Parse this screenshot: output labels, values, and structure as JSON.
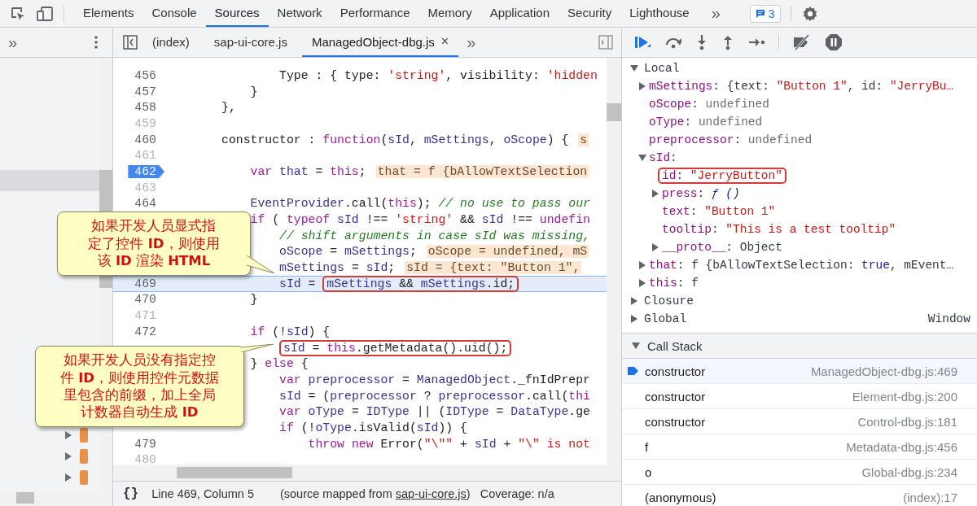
{
  "top_tabs": [
    {
      "label": "Elements",
      "selected": false
    },
    {
      "label": "Console",
      "selected": false
    },
    {
      "label": "Sources",
      "selected": true
    },
    {
      "label": "Network",
      "selected": false
    },
    {
      "label": "Performance",
      "selected": false
    },
    {
      "label": "Memory",
      "selected": false
    },
    {
      "label": "Application",
      "selected": false
    },
    {
      "label": "Security",
      "selected": false
    },
    {
      "label": "Lighthouse",
      "selected": false
    }
  ],
  "more_tabs": "»",
  "issues_count": "3",
  "navigator": {
    "more": "»"
  },
  "file_tabs": [
    {
      "label": "(index)",
      "selected": false,
      "closable": false
    },
    {
      "label": "sap-ui-core.js",
      "selected": false,
      "closable": false
    },
    {
      "label": "ManagedObject-dbg.js",
      "selected": true,
      "closable": true
    }
  ],
  "file_tabs_more": "»",
  "close_glyph": "×",
  "code": {
    "lines": [
      {
        "children": [
          {
            "children": [
              {
                "number": "456",
                "tokens": [
                  {
                    "kind": "plain",
                    "text": "Type : { type: "
                  },
                  {
                    "kind": "string",
                    "text": "'string'"
                  },
                  {
                    "kind": "plain",
                    "text": ", visibility: "
                  },
                  {
                    "kind": "string",
                    "text": "'hidden"
                  }
                ]
              }
            ]
          },
          {
            "number": "457",
            "tokens": [
              {
                "kind": "plain",
                "text": "}"
              }
            ]
          }
        ]
      },
      {
        "number": "458",
        "tokens": [
          {
            "kind": "plain",
            "text": "},"
          }
        ]
      },
      {
        "number": "459"
      },
      {
        "number": "460",
        "tokens": [
          {
            "kind": "plain",
            "text": "constructor : "
          },
          {
            "kind": "keyword",
            "text": "function"
          },
          {
            "kind": "plain",
            "text": "("
          },
          {
            "kind": "variable",
            "text": "sId"
          },
          {
            "kind": "plain",
            "text": ", "
          },
          {
            "kind": "variable",
            "text": "mSettings"
          },
          {
            "kind": "plain",
            "text": ", "
          },
          {
            "kind": "variable",
            "text": "oScope"
          },
          {
            "kind": "plain",
            "text": ") {"
          },
          {
            "kind": "inline",
            "text": "s"
          }
        ],
        "children": [
          {
            "number": "461"
          },
          {
            "number": "462",
            "breakpoint": true,
            "tokens": [
              {
                "kind": "keyword",
                "text": "var"
              },
              {
                "kind": "variable",
                "text": " that"
              },
              {
                "kind": "plain",
                "text": " = "
              },
              {
                "kind": "keyword",
                "text": "this"
              },
              {
                "kind": "plain",
                "text": ";"
              },
              {
                "kind": "inline",
                "text": "that = f {bAllowTextSelection"
              }
            ]
          },
          {
            "number": "463"
          },
          {
            "number": "464",
            "tokens": [
              {
                "kind": "variable",
                "text": "EventProvider"
              },
              {
                "kind": "plain",
                "text": ".call("
              },
              {
                "kind": "keyword",
                "text": "this"
              },
              {
                "kind": "plain",
                "text": "); "
              },
              {
                "kind": "comment",
                "text": "// no use to pass our"
              }
            ]
          },
          {
            "tokens": [
              {
                "kind": "keyword",
                "text": "if"
              },
              {
                "kind": "plain",
                "text": " ( "
              },
              {
                "kind": "keyword",
                "text": "typeof"
              },
              {
                "kind": "variable",
                "text": " sId"
              },
              {
                "kind": "plain",
                "text": " !== "
              },
              {
                "kind": "string",
                "text": "'string'"
              },
              {
                "kind": "plain",
                "text": " && "
              },
              {
                "kind": "variable",
                "text": "sId"
              },
              {
                "kind": "plain",
                "text": " !== "
              },
              {
                "kind": "keyword",
                "text": "undefin"
              }
            ],
            "children": [
              {
                "tokens": [
                  {
                    "kind": "comment",
                    "text": "// shift arguments in case sId was missing,"
                  }
                ]
              },
              {
                "tokens": [
                  {
                    "kind": "variable",
                    "text": "oScope"
                  },
                  {
                    "kind": "plain",
                    "text": " = "
                  },
                  {
                    "kind": "variable",
                    "text": "mSettings"
                  },
                  {
                    "kind": "plain",
                    "text": ";"
                  },
                  {
                    "kind": "inline",
                    "text": "oScope = undefined, mS"
                  }
                ]
              },
              {
                "tokens": [
                  {
                    "kind": "variable",
                    "text": "mSettings"
                  },
                  {
                    "kind": "plain",
                    "text": " = "
                  },
                  {
                    "kind": "variable",
                    "text": "sId"
                  },
                  {
                    "kind": "plain",
                    "text": ";"
                  },
                  {
                    "kind": "inline",
                    "text": "sId = {text: \"Button 1\","
                  }
                ]
              },
              {
                "number": "469",
                "current": true,
                "tokens": [
                  {
                    "kind": "variable",
                    "text": "sId"
                  },
                  {
                    "kind": "plain",
                    "text": " = "
                  }
                ],
                "boxed_tokens": [
                  {
                    "kind": "variable",
                    "text": "mSettings"
                  },
                  {
                    "kind": "plain",
                    "text": " && "
                  },
                  {
                    "kind": "variable",
                    "text": "mSettings"
                  },
                  {
                    "kind": "plain",
                    "text": ".id;"
                  }
                ]
              }
            ]
          },
          {
            "number": "470",
            "tokens": [
              {
                "kind": "plain",
                "text": "}"
              }
            ]
          },
          {
            "number": "471"
          },
          {
            "number": "472",
            "tokens": [
              {
                "kind": "keyword",
                "text": "if"
              },
              {
                "kind": "plain",
                "text": " (!"
              },
              {
                "kind": "variable",
                "text": "sId"
              },
              {
                "kind": "plain",
                "text": ") {"
              }
            ],
            "children": [
              {
                "boxed_tokens": [
                  {
                    "kind": "variable",
                    "text": "sId"
                  },
                  {
                    "kind": "plain",
                    "text": " = "
                  },
                  {
                    "kind": "keyword",
                    "text": "this"
                  },
                  {
                    "kind": "plain",
                    "text": ".getMetadata().uid();"
                  }
                ]
              }
            ]
          },
          {
            "tokens": [
              {
                "kind": "plain",
                "text": "} "
              },
              {
                "kind": "keyword",
                "text": "else"
              },
              {
                "kind": "plain",
                "text": " {"
              }
            ],
            "children": [
              {
                "tokens": [
                  {
                    "kind": "keyword",
                    "text": "var"
                  },
                  {
                    "kind": "variable",
                    "text": " preprocessor"
                  },
                  {
                    "kind": "plain",
                    "text": " = "
                  },
                  {
                    "kind": "variable",
                    "text": "ManagedObject"
                  },
                  {
                    "kind": "plain",
                    "text": "._fnIdPrepr"
                  }
                ]
              },
              {
                "tokens": [
                  {
                    "kind": "variable",
                    "text": "sId"
                  },
                  {
                    "kind": "plain",
                    "text": " = ("
                  },
                  {
                    "kind": "variable",
                    "text": "preprocessor"
                  },
                  {
                    "kind": "plain",
                    "text": " ? "
                  },
                  {
                    "kind": "variable",
                    "text": "preprocessor"
                  },
                  {
                    "kind": "plain",
                    "text": ".call("
                  },
                  {
                    "kind": "keyword",
                    "text": "thi"
                  }
                ]
              },
              {
                "tokens": [
                  {
                    "kind": "keyword",
                    "text": "var"
                  },
                  {
                    "kind": "variable",
                    "text": " oType"
                  },
                  {
                    "kind": "plain",
                    "text": " = "
                  },
                  {
                    "kind": "variable",
                    "text": "IDType"
                  },
                  {
                    "kind": "plain",
                    "text": " || ("
                  },
                  {
                    "kind": "variable",
                    "text": "IDType"
                  },
                  {
                    "kind": "plain",
                    "text": " = "
                  },
                  {
                    "kind": "variable",
                    "text": "DataType"
                  },
                  {
                    "kind": "plain",
                    "text": ".ge"
                  }
                ]
              },
              {
                "tokens": [
                  {
                    "kind": "keyword",
                    "text": "if"
                  },
                  {
                    "kind": "plain",
                    "text": " (!"
                  },
                  {
                    "kind": "variable",
                    "text": "oType"
                  },
                  {
                    "kind": "plain",
                    "text": ".isValid("
                  },
                  {
                    "kind": "variable",
                    "text": "sId"
                  },
                  {
                    "kind": "plain",
                    "text": ")) {"
                  }
                ],
                "children": [
                  {
                    "number": "479",
                    "tokens": [
                      {
                        "kind": "keyword",
                        "text": "throw"
                      },
                      {
                        "kind": "keyword",
                        "text": " new"
                      },
                      {
                        "kind": "plain",
                        "text": " Error("
                      },
                      {
                        "kind": "string",
                        "text": "\"\\\"\""
                      },
                      {
                        "kind": "plain",
                        "text": " + "
                      },
                      {
                        "kind": "variable",
                        "text": "sId"
                      },
                      {
                        "kind": "plain",
                        "text": " + "
                      },
                      {
                        "kind": "string",
                        "text": "\"\\\" is not"
                      }
                    ]
                  }
                ]
              },
              {
                "number": "480"
              }
            ]
          }
        ]
      }
    ]
  },
  "callouts": [
    {
      "text": "如果开发人员显式指定了控件 **ID**，则使用该 **ID** 渲染 **HTML**"
    },
    {
      "text": "如果开发人员没有指定控件 **ID**，则使用控件元数据里包含的前缀，加上全局计数器自动生成 **ID**"
    }
  ],
  "status_bar": {
    "format_glyph": "{}",
    "position": "Line 469, Column 5",
    "source_before": "(source mapped from ",
    "source_link": "sap-ui-core.js",
    "source_after": ")",
    "coverage": "Coverage: n/a"
  },
  "scope": [
    {
      "title": "Local",
      "expanded": true,
      "items": [
        {
          "name": "mSettings",
          "kind": "node",
          "expanded": false,
          "highlighted": false,
          "value": [
            {
              "kind": "plain",
              "text": ": {text: "
            },
            {
              "kind": "string",
              "text": "\"Button 1\""
            },
            {
              "kind": "plain",
              "text": ", id: "
            },
            {
              "kind": "string",
              "text": "\"JerryBu…"
            }
          ]
        },
        {
          "name": "oScope",
          "kind": "leaf",
          "highlighted": false,
          "value": [
            {
              "kind": "plain",
              "text": ":"
            },
            {
              "kind": "dim",
              "text": " undefined"
            }
          ]
        },
        {
          "name": "oType",
          "kind": "leaf",
          "highlighted": false,
          "value": [
            {
              "kind": "plain",
              "text": ":"
            },
            {
              "kind": "dim",
              "text": " undefined"
            }
          ]
        },
        {
          "name": "preprocessor",
          "kind": "leaf",
          "highlighted": false,
          "value": [
            {
              "kind": "plain",
              "text": ":"
            },
            {
              "kind": "dim",
              "text": " undefined"
            }
          ]
        },
        {
          "name": "sId",
          "kind": "node",
          "expanded": true,
          "highlighted": false,
          "value": [
            {
              "kind": "plain",
              "text": ":"
            }
          ],
          "children": [
            {
              "name": "id",
              "kind": "leaf",
              "highlighted": true,
              "value": [
                {
                  "kind": "plain",
                  "text": ":"
                },
                {
                  "kind": "string",
                  "text": " \"JerryButton\""
                }
              ]
            },
            {
              "name": "press",
              "kind": "node",
              "expanded": false,
              "highlighted": false,
              "value": [
                {
                  "kind": "plain",
                  "text": ":"
                },
                {
                  "kind": "func",
                  "text": " ƒ ()"
                }
              ]
            },
            {
              "name": "text",
              "kind": "leaf",
              "highlighted": false,
              "value": [
                {
                  "kind": "plain",
                  "text": ":"
                },
                {
                  "kind": "string",
                  "text": " \"Button 1\""
                }
              ]
            },
            {
              "name": "tooltip",
              "kind": "leaf",
              "highlighted": false,
              "value": [
                {
                  "kind": "plain",
                  "text": ":"
                },
                {
                  "kind": "string",
                  "text": " \"This is a test tooltip\""
                }
              ]
            },
            {
              "name": "__proto__",
              "kind": "node",
              "expanded": false,
              "highlighted": false,
              "value": [
                {
                  "kind": "plain",
                  "text": ": Object"
                }
              ]
            }
          ]
        },
        {
          "name": "that",
          "kind": "node",
          "expanded": false,
          "highlighted": false,
          "value": [
            {
              "kind": "plain",
              "text": ": f {bAllowTextSelection: "
            },
            {
              "kind": "keyword",
              "text": "true"
            },
            {
              "kind": "plain",
              "text": ", mEvent…"
            }
          ]
        },
        {
          "name": "this",
          "kind": "node",
          "expanded": false,
          "highlighted": false,
          "value": [
            {
              "kind": "plain",
              "text": ": f"
            }
          ]
        }
      ]
    },
    {
      "title": "Closure",
      "expanded": false
    },
    {
      "title": "Global",
      "expanded": false,
      "value": "Window"
    }
  ],
  "call_stack": {
    "title": "Call Stack",
    "expanded": true,
    "frames": [
      {
        "name": "constructor",
        "location": "ManagedObject-dbg.js:469",
        "selected": true
      },
      {
        "name": "constructor",
        "location": "Element-dbg.js:200",
        "selected": false
      },
      {
        "name": "constructor",
        "location": "Control-dbg.js:181",
        "selected": false
      },
      {
        "name": "f",
        "location": "Metadata-dbg.js:456",
        "selected": false
      },
      {
        "name": "o",
        "location": "Global-dbg.js:234",
        "selected": false
      },
      {
        "name": "(anonymous)",
        "location": "(index):17",
        "selected": false
      }
    ]
  }
}
